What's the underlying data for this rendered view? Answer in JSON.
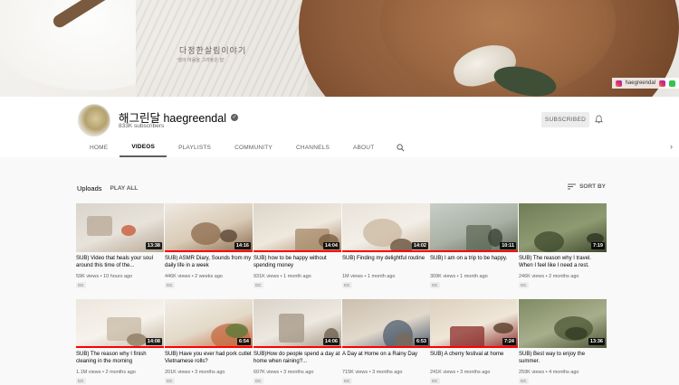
{
  "banner": {
    "title_kr": "다정한살림이야기",
    "subtitle_kr": "'행의 마음을 그려놓은 달'",
    "link_label": "haegreendal"
  },
  "channel": {
    "name": "해그린달 haegreendal",
    "subscribers": "833K subscribers",
    "subscribe_label": "SUBSCRIBED"
  },
  "tabs": [
    {
      "label": "HOME"
    },
    {
      "label": "VIDEOS"
    },
    {
      "label": "PLAYLISTS"
    },
    {
      "label": "COMMUNITY"
    },
    {
      "label": "CHANNELS"
    },
    {
      "label": "ABOUT"
    }
  ],
  "uploads": {
    "title": "Uploads",
    "play_all": "PLAY ALL",
    "sort_label": "SORT BY"
  },
  "videos": [
    {
      "title": "SUB) Video that heals your soul around this time of the...",
      "meta": "59K views • 10 hours ago",
      "duration": "13:38",
      "cc": "CC",
      "watched": 0,
      "palette": [
        "#d9d4cc",
        "#b8a896",
        "#e7e2da",
        "#c95c3b"
      ]
    },
    {
      "title": "SUB) ASMR Diary, Sounds from my daily life in a week",
      "meta": "446K views • 2 weeks ago",
      "duration": "14:16",
      "cc": "CC",
      "watched": 1.0,
      "palette": [
        "#efe9e1",
        "#8c6a4b",
        "#d9cbb7",
        "#5b4634"
      ]
    },
    {
      "title": "SUB) how to be happy without spending money",
      "meta": "931K views • 1 month ago",
      "duration": "14:04",
      "cc": "CC",
      "watched": 1.0,
      "palette": [
        "#dcd5c9",
        "#a7896a",
        "#efe8dd",
        "#7c5f44"
      ]
    },
    {
      "title": "SUB) Finding my delightful routine",
      "meta": "1M views • 1 month ago",
      "duration": "14:02",
      "cc": "CC",
      "watched": 1.0,
      "palette": [
        "#e8e2d9",
        "#c9b79f",
        "#f3efe8",
        "#6b5240"
      ]
    },
    {
      "title": "SUB) I am on a trip to be happy.",
      "meta": "309K views • 1 month ago",
      "duration": "10:11",
      "cc": "CC",
      "watched": 1.0,
      "palette": [
        "#c9cfc8",
        "#5f6a57",
        "#a9b0a4",
        "#3b4537"
      ]
    },
    {
      "title": "SUB) The reason why I travel. When I feel like I need a rest.",
      "meta": "246K views • 2 months ago",
      "duration": "7:19",
      "cc": "CC",
      "watched": 0,
      "palette": [
        "#6f7d56",
        "#3f4a2d",
        "#8f9a72",
        "#2d3520"
      ]
    },
    {
      "title": "SUB) The reason why I finish cleaning in the morning",
      "meta": "1.1M views • 2 months ago",
      "duration": "14:08",
      "cc": "CC",
      "watched": 1.0,
      "palette": [
        "#ece6dd",
        "#c7b8a3",
        "#f6f2ec",
        "#8f7a62"
      ]
    },
    {
      "title": "SUB) Have you ever had pork cutlet Vietnamese rolls?",
      "meta": "201K views • 3 months ago",
      "duration": "6:54",
      "cc": "CC",
      "watched": 1.0,
      "palette": [
        "#f2eee7",
        "#c46a3f",
        "#e3d9c8",
        "#5d7a3a"
      ]
    },
    {
      "title": "SUB)How do people spend a day at home when raining?...",
      "meta": "607K views • 3 months ago",
      "duration": "14:06",
      "cc": "CC",
      "watched": 1.0,
      "palette": [
        "#d8d2c8",
        "#a39684",
        "#ede8e0",
        "#6f6252"
      ]
    },
    {
      "title": "A Day at Home on a Rainy Day",
      "meta": "715K views • 3 months ago",
      "duration": "6:53",
      "cc": "CC",
      "watched": 1.0,
      "palette": [
        "#cbbfae",
        "#4f5c6e",
        "#e2d9cc",
        "#7b6a57"
      ]
    },
    {
      "title": "SUB) A cherry festival at home",
      "meta": "241K views • 3 months ago",
      "duration": "7:24",
      "cc": "CC",
      "watched": 1.0,
      "palette": [
        "#dccfbd",
        "#8b2c2a",
        "#efe6d8",
        "#5a3d2a"
      ]
    },
    {
      "title": "SUB) Best way to enjoy the summer.",
      "meta": "259K views • 4 months ago",
      "duration": "13:36",
      "cc": "CC",
      "watched": 0,
      "palette": [
        "#7f8a62",
        "#4c5636",
        "#a7ae8c",
        "#333b24"
      ]
    }
  ]
}
